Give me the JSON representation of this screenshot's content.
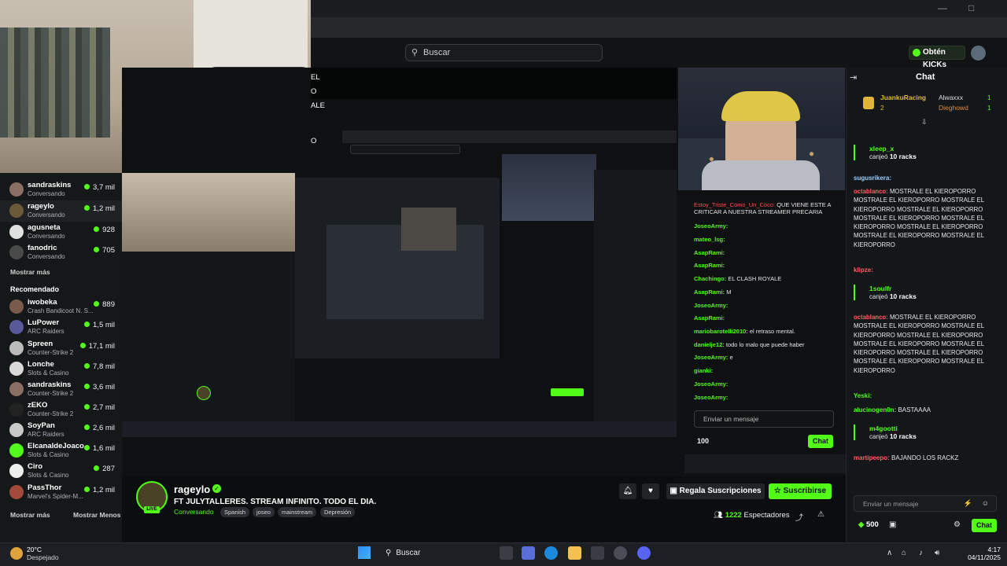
{
  "browser": {
    "search_placeholder": "Buscar",
    "kicks_button": "Obtén KICKs"
  },
  "sidebar": {
    "following": [
      {
        "name": "sandraskins",
        "category": "Conversando",
        "viewers": "3,7 mil"
      },
      {
        "name": "rageylo",
        "category": "Conversando",
        "viewers": "1,2 mil"
      },
      {
        "name": "agusneta",
        "category": "Conversando",
        "viewers": "928"
      },
      {
        "name": "fanodric",
        "category": "Conversando",
        "viewers": "705"
      }
    ],
    "show_more": "Mostrar más",
    "recommended_title": "Recomendado",
    "recommended": [
      {
        "name": "iwobeka",
        "category": "Crash Bandicoot N. S...",
        "viewers": "889"
      },
      {
        "name": "LuPower",
        "category": "ARC Raiders",
        "viewers": "1,5 mil"
      },
      {
        "name": "Spreen",
        "category": "Counter-Strike 2",
        "viewers": "17,1 mil"
      },
      {
        "name": "Lonche",
        "category": "Slots & Casino",
        "viewers": "7,8 mil"
      },
      {
        "name": "sandraskins",
        "category": "Counter-Strike 2",
        "viewers": "3,6 mil"
      },
      {
        "name": "zEKO",
        "category": "Counter-Strike 2",
        "viewers": "2,7 mil"
      },
      {
        "name": "SoyPan",
        "category": "ARC Raiders",
        "viewers": "2,6 mil"
      },
      {
        "name": "ElcanaldeJoaco",
        "category": "Slots & Casino",
        "viewers": "1,6 mil"
      },
      {
        "name": "Ciro",
        "category": "Slots & Casino",
        "viewers": "287"
      },
      {
        "name": "PassThor",
        "category": "Marvel's Spider-M...",
        "viewers": "1,2 mil"
      }
    ],
    "show_more_2": "Mostrar más",
    "show_less": "Mostrar Menos"
  },
  "stream": {
    "name": "rageylo",
    "title": "FT JULYTALLERES. STREAM INFINITO. TODO EL DIA.",
    "category": "Conversando",
    "tags": [
      "Spanish",
      "joseo",
      "mainstream",
      "Depresión"
    ],
    "gift_button": "Regala Suscripciones",
    "subscribe_button": "Suscribirse",
    "viewers": "1222",
    "viewers_label": "Espectadores",
    "live_badge": "LIVE"
  },
  "inner_stream": {
    "overlay_lines": [
      "EL",
      "O",
      "ALE",
      "O"
    ],
    "chat": [
      {
        "user": "Estoy_Triste_Como_Un_Coco:",
        "text": "QUE VIENE ESTE A CRITICAR A NUESTRA STREAMER PRECARIA",
        "red": true
      },
      {
        "user": "JoseoArmy:",
        "text": ""
      },
      {
        "user": "mateo_lsg:",
        "text": ""
      },
      {
        "user": "AsapRami:",
        "text": ""
      },
      {
        "user": "AsapRami:",
        "text": ""
      },
      {
        "user": "Chachingo:",
        "text": "EL CLASH ROYALE"
      },
      {
        "user": "AsapRami:",
        "text": "M"
      },
      {
        "user": "JoseoArmy:",
        "text": ""
      },
      {
        "user": "AsapRami:",
        "text": ""
      },
      {
        "user": "mariobarotelli2010:",
        "text": "el retraso mental."
      },
      {
        "user": "danielje12:",
        "text": "todo lo malo que puede haber"
      },
      {
        "user": "JoseoArmy:",
        "text": "e"
      },
      {
        "user": "gianki:",
        "text": ""
      },
      {
        "user": "JoseoArmy:",
        "text": ""
      },
      {
        "user": "JoseoArmy:",
        "text": ""
      }
    ],
    "input_placeholder": "Enviar un mensaje",
    "points": "100",
    "chat_button": "Chat"
  },
  "chat": {
    "title": "Chat",
    "leaderboard": [
      {
        "rank": "1",
        "name": "JuankuRacing",
        "count": "2"
      },
      {
        "rank": "",
        "name": "Alwaxxx",
        "count": "1"
      },
      {
        "rank": "",
        "name": "Dieghowd",
        "count": "1"
      }
    ],
    "sub1": {
      "user": "xleep_x",
      "text": "canjeó",
      "reward": "10 racks"
    },
    "msg_sugus": {
      "user": "sugusrikera:",
      "text": ""
    },
    "msg_octa1": {
      "user": "octablanco:",
      "text": "MOSTRALE EL KIEROPORRO MOSTRALE EL KIEROPORRO MOSTRALE EL KIEROPORRO MOSTRALE EL KIEROPORRO MOSTRALE EL KIEROPORRO MOSTRALE EL KIEROPORRO MOSTRALE EL KIEROPORRO MOSTRALE EL KIEROPORRO MOSTRALE EL KIEROPORRO"
    },
    "msg_klipze": {
      "user": "klipze:",
      "text": ""
    },
    "sub2": {
      "user": "1soulfr",
      "text": "canjeó",
      "reward": "10 racks"
    },
    "msg_octa2": {
      "user": "octablanco:",
      "text": "MOSTRALE EL KIEROPORRO MOSTRALE EL KIEROPORRO MOSTRALE EL KIEROPORRO MOSTRALE EL KIEROPORRO MOSTRALE EL KIEROPORRO MOSTRALE EL KIEROPORRO MOSTRALE EL KIEROPORRO MOSTRALE EL KIEROPORRO MOSTRALE EL KIEROPORRO"
    },
    "msg_yeski": {
      "user": "Yeski:",
      "text": ""
    },
    "msg_alucinogen": {
      "user": "alucinogen0n:",
      "text": "BASTAAAA"
    },
    "sub3": {
      "user": "m4gootti",
      "text": "canjeó",
      "reward": "10 racks"
    },
    "msg_martin": {
      "user": "martipeepo:",
      "text": "BAJANDO LOS RACKZ"
    },
    "input_placeholder": "Enviar un mensaje",
    "points": "500",
    "chat_button": "Chat"
  },
  "taskbar": {
    "temp": "20°C",
    "condition": "Despejado",
    "search": "Buscar",
    "time": "4:17",
    "date": "04/11/2025"
  },
  "colors": {
    "accent": "#53fc18",
    "bg": "#0b0e0f"
  }
}
